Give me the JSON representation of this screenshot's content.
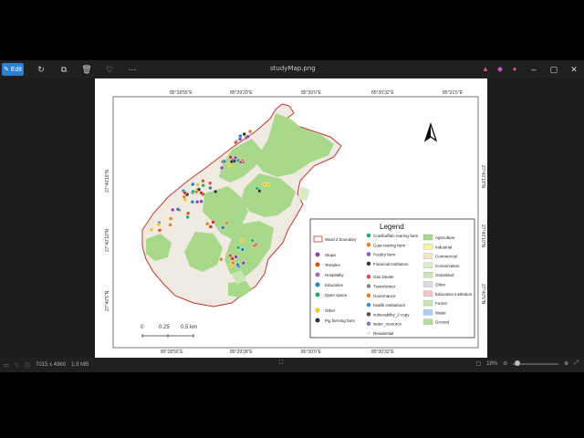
{
  "window": {
    "title": "studyMap.png",
    "edit_label": "Edit"
  },
  "status": {
    "dimensions": "7015 x 4960",
    "size": "1.9 MB",
    "zoom": "18%"
  },
  "map": {
    "top_coords": [
      "85°28'55\"E",
      "85°29'20\"E",
      "85°30'0\"E",
      "85°30'32\"E",
      "85°31'5\"E"
    ],
    "bottom_coords": [
      "85°28'55\"E",
      "85°29'28\"E",
      "85°30'0\"E",
      "85°30'32\"E"
    ],
    "left_coords": [
      "27°40'18\"N",
      "27°40'10\"N",
      "27°40'5\"N",
      "27°39'58\"N"
    ],
    "scale": {
      "zero": "0",
      "mid": "0.25",
      "end": "0.5 km"
    }
  },
  "legend": {
    "title": "Legend",
    "col1": [
      "Ward 2 boundary",
      "Stupa",
      "Temples",
      "Hospitality",
      "Education",
      "Open space",
      "Other",
      "Pig farming farm"
    ],
    "col2": [
      "Cow/buffalo rearing farm",
      "Goat rearing farm",
      "Poultry farm",
      "Financial Institution",
      "Gas Dealer",
      "Transformer",
      "Governance",
      "health institution2",
      "vulnerability_2 copy",
      "water_resource",
      "Residential"
    ],
    "col3": [
      "Agriculture",
      "Industrial",
      "Commercial",
      "Conservation",
      "Grassland",
      "Other",
      "Education institution",
      "Forest",
      "Water",
      "Ground"
    ]
  },
  "colors": {
    "green": "#a8d88a",
    "residential": "#efeae2",
    "boundary": "#c0392b"
  }
}
